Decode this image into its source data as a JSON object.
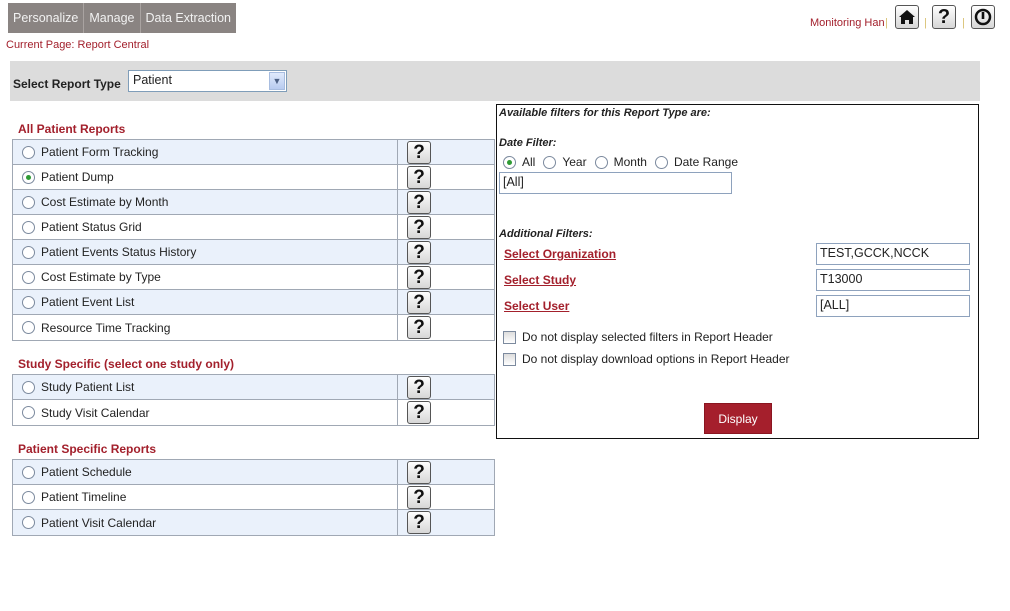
{
  "nav": [
    "Personalize",
    "Manage",
    "Data Extraction"
  ],
  "breadcrumb": "Current Page: Report Central",
  "user": {
    "name": "Monitoring Han",
    "separator": "|"
  },
  "icons": {
    "home": "home-icon",
    "help": "?",
    "logout": "power-icon"
  },
  "report_type": {
    "label": "Select Report Type",
    "value": "Patient"
  },
  "sections": [
    {
      "title": "All Patient Reports",
      "items": [
        "Patient Form Tracking",
        "Patient Dump",
        "Cost Estimate by Month",
        "Patient Status Grid",
        "Patient Events Status History",
        "Cost Estimate by Type",
        "Patient Event List",
        "Resource Time Tracking"
      ],
      "selected": 1
    },
    {
      "title": "Study Specific (select one study only)",
      "items": [
        "Study Patient List",
        "Study Visit Calendar"
      ],
      "selected": -1
    },
    {
      "title": "Patient Specific Reports",
      "items": [
        "Patient Schedule",
        "Patient Timeline",
        "Patient Visit Calendar"
      ],
      "selected": -1
    }
  ],
  "help_glyph": "?",
  "filters": {
    "heading": "Available filters for this Report Type are:",
    "date_heading": "Date Filter:",
    "date_options": [
      "All",
      "Year",
      "Month",
      "Date Range"
    ],
    "date_selected": 0,
    "date_value": "[All]",
    "additional_heading": "Additional Filters:",
    "organization": {
      "label": "Select Organization",
      "value": "TEST,GCCK,NCCK"
    },
    "study": {
      "label": "Select Study",
      "value": "T13000"
    },
    "user": {
      "label": "Select User",
      "value": "[ALL]"
    },
    "checkbox1": "Do not display selected filters in Report Header",
    "checkbox2": "Do not display download options in Report Header",
    "display_button": "Display"
  },
  "colors": {
    "accent": "#a3202c",
    "nav_bg": "#8a8482",
    "row_alt": "#eaf1fb"
  }
}
